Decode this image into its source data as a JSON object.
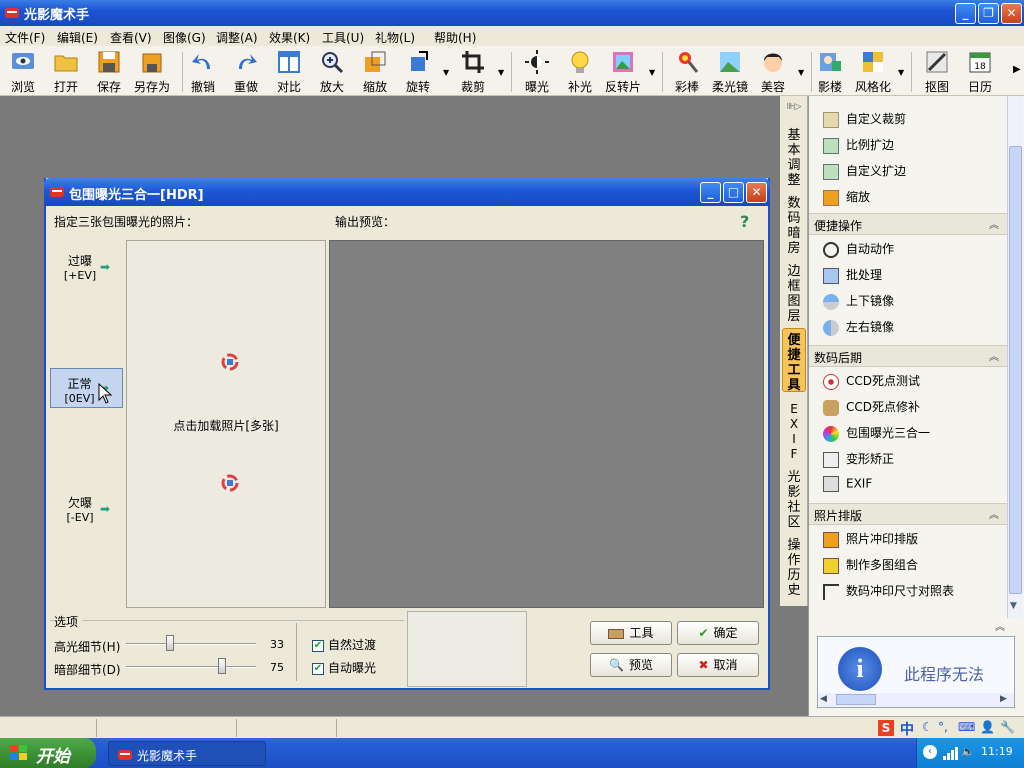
{
  "window": {
    "title": "光影魔术手"
  },
  "menu": [
    "文件(F)",
    "编辑(E)",
    "查看(V)",
    "图像(G)",
    "调整(A)",
    "效果(K)",
    "工具(U)",
    "礼物(L)",
    "帮助(H)"
  ],
  "toolbar": {
    "browse": "浏览",
    "open": "打开",
    "save": "保存",
    "saveas": "另存为",
    "undo": "撤销",
    "redo": "重做",
    "compare": "对比",
    "zoomin": "放大",
    "resize": "缩放",
    "rotate": "旋转",
    "crop": "裁剪",
    "exposure": "曝光",
    "fill": "补光",
    "reverse": "反转片",
    "colorpen": "彩棒",
    "soft": "柔光镜",
    "beauty": "美容",
    "studio": "影楼",
    "style": "风格化",
    "cutout": "抠图",
    "calendar": "日历"
  },
  "vtabs": [
    "基本调整",
    "数码暗房",
    "边框图层",
    "便捷工具",
    "EXIF",
    "光影社区",
    "操作历史"
  ],
  "rpanel": {
    "top_items": [
      "自定义裁剪",
      "比例扩边",
      "自定义扩边",
      "缩放"
    ],
    "sections": [
      {
        "title": "便捷操作",
        "items": [
          "自动动作",
          "批处理",
          "上下镜像",
          "左右镜像"
        ]
      },
      {
        "title": "数码后期",
        "items": [
          "CCD死点测试",
          "CCD死点修补",
          "包围曝光三合一",
          "变形矫正",
          "EXIF"
        ]
      },
      {
        "title": "照片排版",
        "items": [
          "照片冲印排版",
          "制作多图组合",
          "数码冲印尺寸对照表"
        ]
      }
    ],
    "ad_text": "此程序无法"
  },
  "dialog": {
    "title": "包围曝光三合一[HDR]",
    "specify_label": "指定三张包围曝光的照片：",
    "preview_label": "输出预览：",
    "help": "?",
    "over": {
      "name": "过曝",
      "ev": "[+EV]"
    },
    "normal": {
      "name": "正常",
      "ev": "[0EV]"
    },
    "under": {
      "name": "欠曝",
      "ev": "[-EV]"
    },
    "load_text": "点击加载照片[多张]",
    "options_title": "选项",
    "highlight_label": "高光细节(H)",
    "highlight_value": "33",
    "highlight_level": 33,
    "shadow_label": "暗部细节(D)",
    "shadow_value": "75",
    "shadow_level": 75,
    "natural_transition": "自然过渡",
    "auto_exposure": "自动曝光",
    "tools_btn": "工具",
    "ok_btn": "确定",
    "preview_btn": "预览",
    "cancel_btn": "取消"
  },
  "taskbar": {
    "start": "开始",
    "task": "光影魔术手",
    "ime": "中",
    "time": "11:19"
  }
}
